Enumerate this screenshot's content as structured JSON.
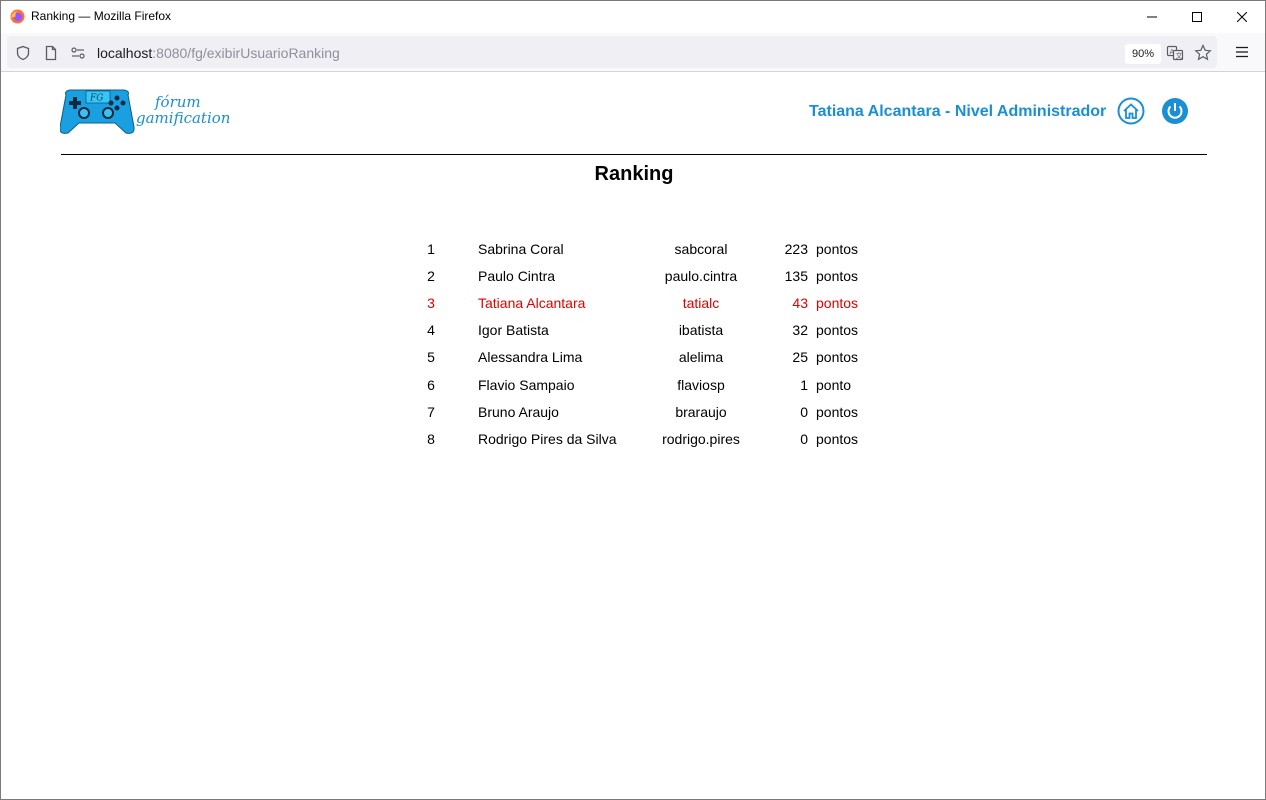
{
  "browser": {
    "window_title": "Ranking — Mozilla Firefox",
    "url_host": "localhost",
    "url_rest": ":8080/fg/exibirUsuarioRanking",
    "zoom": "90%"
  },
  "header": {
    "logo_line1": "fórum",
    "logo_line2": "gamification",
    "logo_badge": "FG",
    "user_label": "Tatiana Alcantara - Nivel Administrador"
  },
  "page": {
    "title": "Ranking"
  },
  "ranking": [
    {
      "rank": "1",
      "name": "Sabrina Coral",
      "username": "sabcoral",
      "points": "223",
      "unit": "pontos"
    },
    {
      "rank": "2",
      "name": "Paulo Cintra",
      "username": "paulo.cintra",
      "points": "135",
      "unit": "pontos"
    },
    {
      "rank": "3",
      "name": "Tatiana Alcantara",
      "username": "tatialc",
      "points": "43",
      "unit": "pontos"
    },
    {
      "rank": "4",
      "name": "Igor Batista",
      "username": "ibatista",
      "points": "32",
      "unit": "pontos"
    },
    {
      "rank": "5",
      "name": "Alessandra Lima",
      "username": "alelima",
      "points": "25",
      "unit": "pontos"
    },
    {
      "rank": "6",
      "name": "Flavio Sampaio",
      "username": "flaviosp",
      "points": "1",
      "unit": "ponto"
    },
    {
      "rank": "7",
      "name": "Bruno Araujo",
      "username": "braraujo",
      "points": "0",
      "unit": "pontos"
    },
    {
      "rank": "8",
      "name": "Rodrigo Pires da Silva",
      "username": "rodrigo.pires",
      "points": "0",
      "unit": "pontos"
    }
  ],
  "colors": {
    "accent": "#1a8fd3",
    "current_user": "#e00000"
  }
}
